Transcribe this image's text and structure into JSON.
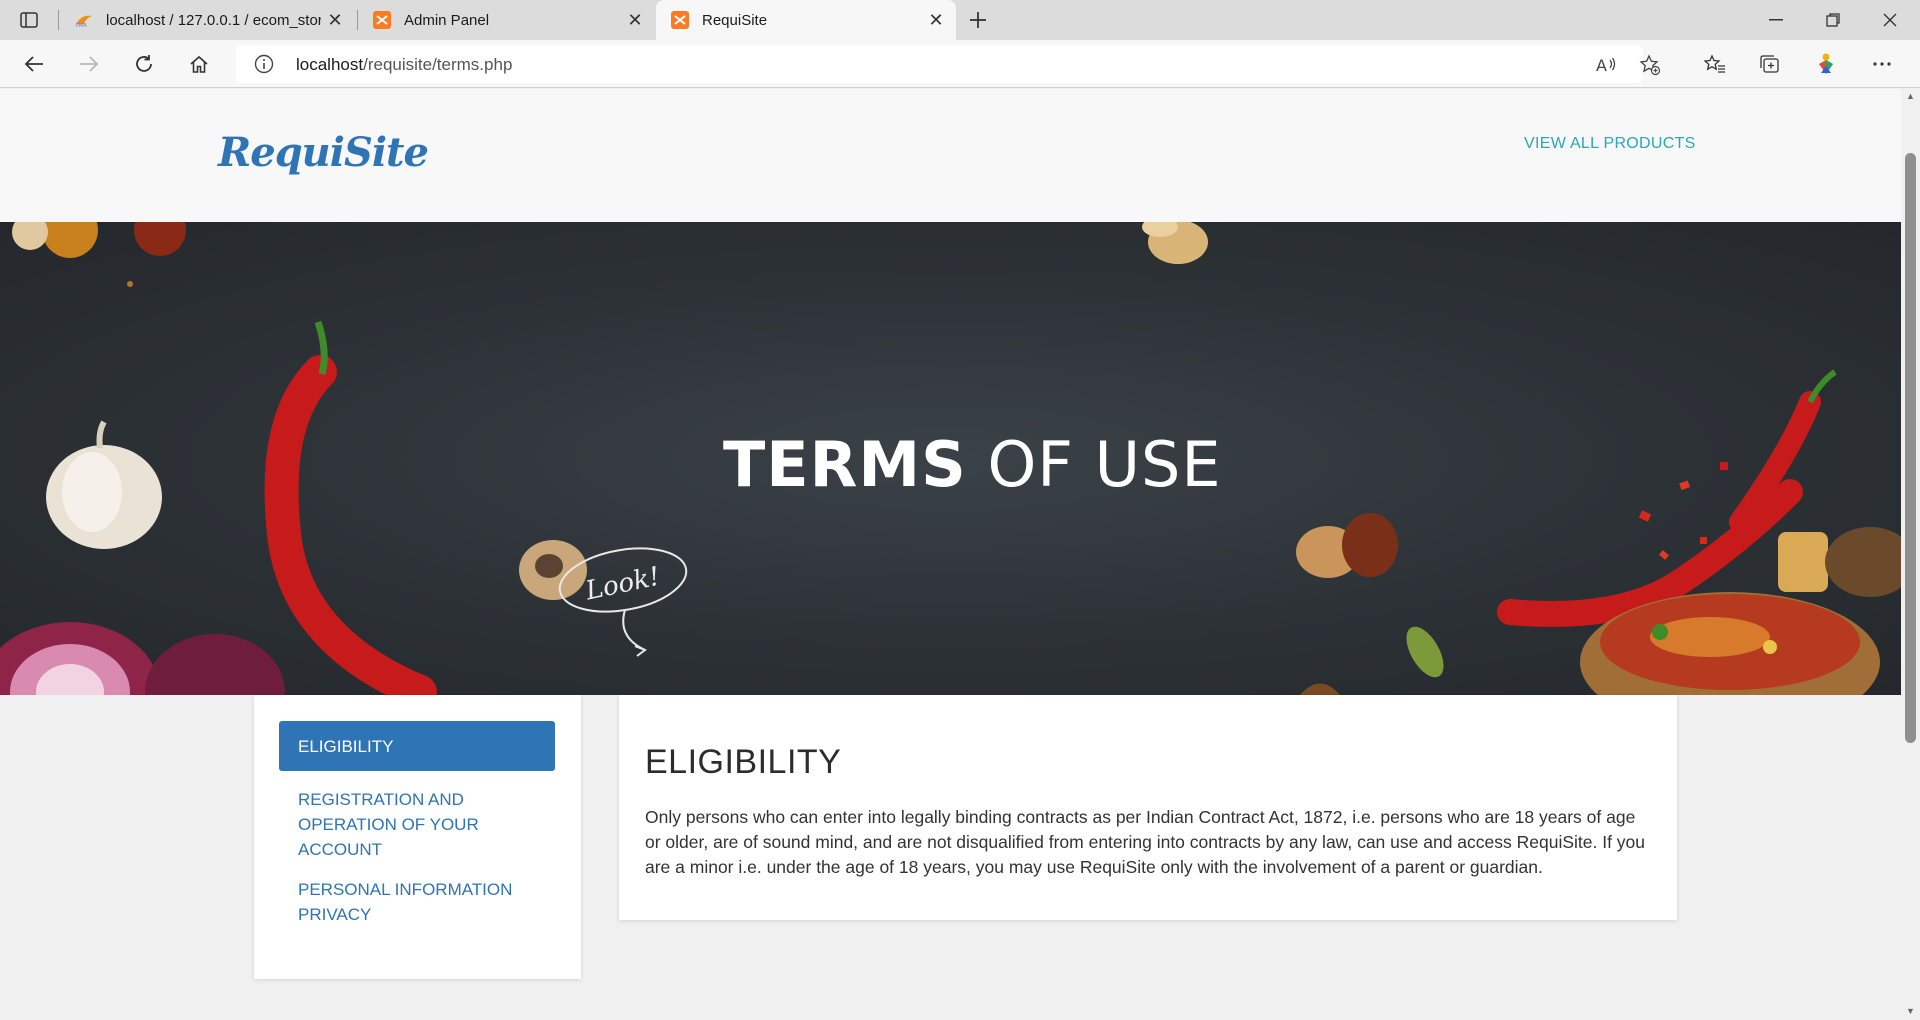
{
  "browser": {
    "tabs": [
      {
        "title": "localhost / 127.0.0.1 / ecom_stor",
        "favicon": "phpmyadmin-icon"
      },
      {
        "title": "Admin Panel",
        "favicon": "xampp-icon"
      },
      {
        "title": "RequiSite",
        "favicon": "xampp-icon",
        "active": true
      }
    ],
    "address": {
      "domain": "localhost",
      "path": "/requisite/terms.php"
    }
  },
  "site": {
    "logo": "RequiSite",
    "nav_link": "VIEW ALL PRODUCTS",
    "brand_color": "#2f74b5",
    "link_color": "#2aa8b5"
  },
  "hero": {
    "title_bold": "TERMS",
    "title_light": "OF USE",
    "bubble_text": "Look!"
  },
  "sidebar": {
    "items": [
      {
        "label": "ELIGIBILITY",
        "active": true
      },
      {
        "label": "REGISTRATION AND OPERATION OF YOUR ACCOUNT"
      },
      {
        "label": "PERSONAL INFORMATION PRIVACY"
      }
    ]
  },
  "content": {
    "heading": "ELIGIBILITY",
    "text": "Only persons who can enter into legally binding contracts as per Indian Contract Act, 1872, i.e. persons who are 18 years of age or older, are of sound mind, and are not disqualified from entering into contracts by any law, can use and access RequiSite. If you are a minor i.e. under the age of 18 years, you may use RequiSite only with the involvement of a parent or guardian."
  }
}
